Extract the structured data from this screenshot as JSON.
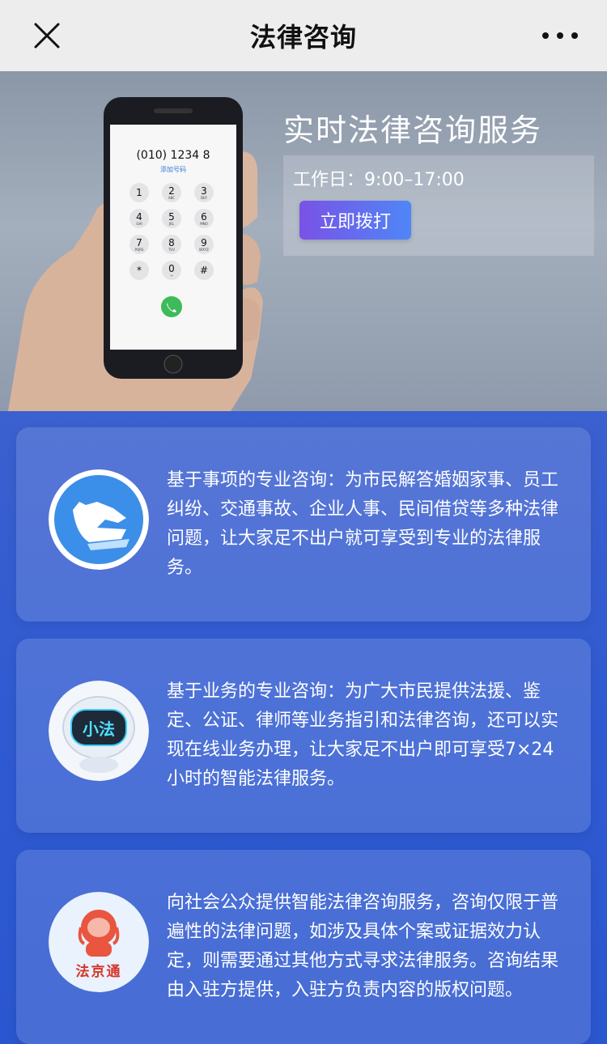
{
  "header": {
    "title": "法律咨询",
    "close_icon": "close-icon",
    "more_icon": "more-icon"
  },
  "hero": {
    "title": "实时法律咨询服务",
    "hours": "工作日：9:00–17:00",
    "call_button": "立即拨打",
    "phone": {
      "number": "(010) 1234 8",
      "add_label": "添加号码",
      "keys": [
        {
          "num": "1",
          "letters": ""
        },
        {
          "num": "2",
          "letters": "ABC"
        },
        {
          "num": "3",
          "letters": "DEF"
        },
        {
          "num": "4",
          "letters": "GHI"
        },
        {
          "num": "5",
          "letters": "JKL"
        },
        {
          "num": "6",
          "letters": "MNO"
        },
        {
          "num": "7",
          "letters": "PQRS"
        },
        {
          "num": "8",
          "letters": "TUV"
        },
        {
          "num": "9",
          "letters": "WXYZ"
        },
        {
          "num": "*",
          "letters": ""
        },
        {
          "num": "0",
          "letters": "+"
        },
        {
          "num": "#",
          "letters": ""
        }
      ]
    }
  },
  "cards": [
    {
      "icon": "wolf-logo-icon",
      "text": "基于事项的专业咨询：为市民解答婚姻家事、员工纠纷、交通事故、企业人事、民间借贷等多种法律问题，让大家足不出户就可享受到专业的法律服务。"
    },
    {
      "icon": "robot-xiaofa-icon",
      "icon_label": "小法",
      "text": "基于业务的专业咨询：为广大市民提供法援、鉴定、公证、律师等业务指引和法律咨询，还可以实现在线业务办理，让大家足不出户即可享受7×24小时的智能法律服务。"
    },
    {
      "icon": "astronaut-fajingtong-icon",
      "icon_label": "法京通",
      "text": "向社会公众提供智能法律咨询服务，咨询仅限于普遍性的法律问题，如涉及具体个案或证据效力认定，则需要通过其他方式寻求法律服务。咨询结果由入驻方提供，入驻方负责内容的版权问题。"
    }
  ],
  "colors": {
    "accent_gradient_start": "#7a52e6",
    "accent_gradient_end": "#4f86f7",
    "background_blue": "#2f56c9"
  }
}
